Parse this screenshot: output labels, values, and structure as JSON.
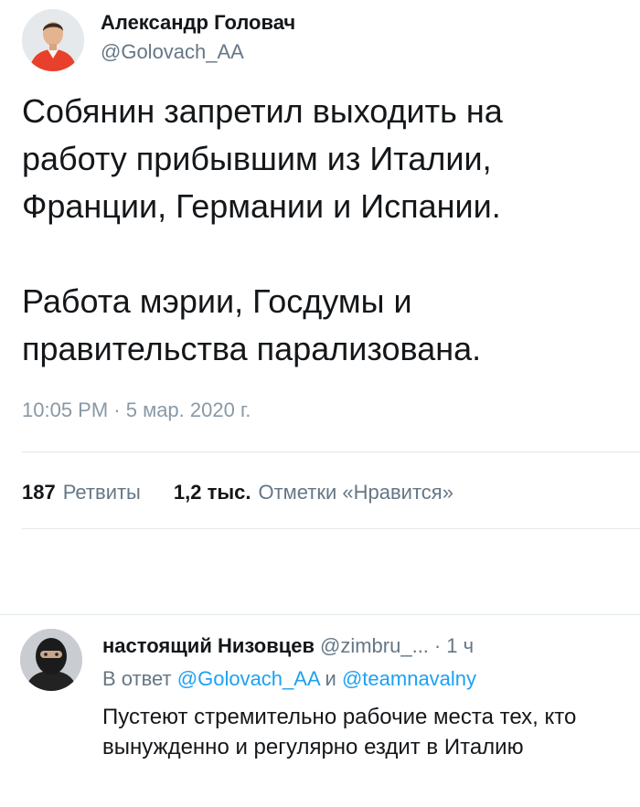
{
  "tweet": {
    "author": {
      "name": "Александр Головач",
      "handle": "@Golovach_AA"
    },
    "text": [
      "Собянин запретил выходить на\nработу прибывшим из Италии,\nФранции, Германии и Испании.",
      "Работа мэрии, Госдумы и\nправительства парализована."
    ],
    "timestamp": "10:05 PM · 5 мар. 2020 г.",
    "stats": {
      "retweets_count": "187",
      "retweets_label": "Ретвиты",
      "likes_count": "1,2 тыс.",
      "likes_label": "Отметки «Нравится»"
    }
  },
  "reply": {
    "name": "настоящий Низовцев",
    "handle": "@zimbru_...",
    "separator": "·",
    "time": "1 ч",
    "reply_to_prefix": "В ответ",
    "reply_to_user1": "@Golovach_AA",
    "reply_to_joiner": "и",
    "reply_to_user2": "@teamnavalny",
    "text": "Пустеют стремительно рабочие места тех, кто вынужденно и регулярно ездит в Италию"
  },
  "colors": {
    "text_primary": "#14171a",
    "text_secondary": "#657786",
    "timestamp": "#8899a6",
    "link": "#1da1f2",
    "divider": "#e1e8ed"
  }
}
